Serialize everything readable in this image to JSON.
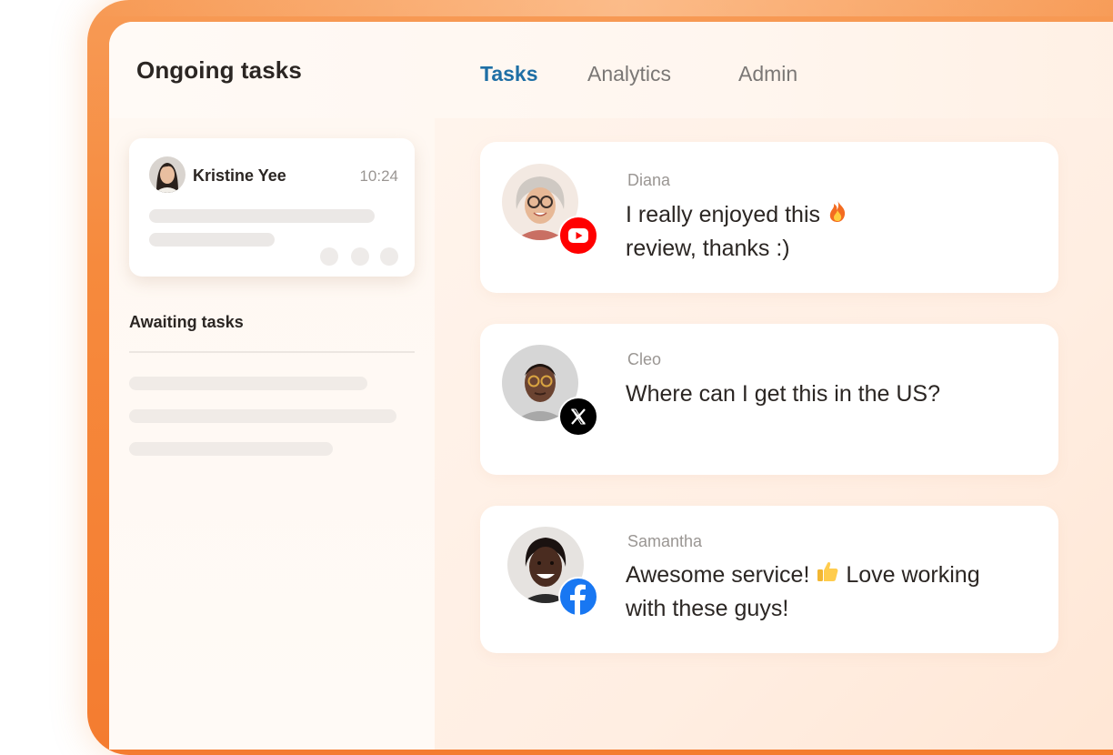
{
  "header": {
    "title": "Ongoing tasks",
    "tabs": [
      {
        "label": "Tasks",
        "active": true
      },
      {
        "label": "Analytics",
        "active": false
      },
      {
        "label": "Admin",
        "active": false
      }
    ]
  },
  "sidebar": {
    "current_task": {
      "name": "Kristine Yee",
      "time": "10:24"
    },
    "awaiting_label": "Awaiting tasks"
  },
  "messages": [
    {
      "author": "Diana",
      "line1": "I really enjoyed this",
      "line2": "review, thanks :)",
      "emoji": "fire-icon",
      "platform": "youtube-icon"
    },
    {
      "author": "Cleo",
      "line1": "Where can I get this in the US?",
      "platform": "x-icon"
    },
    {
      "author": "Samantha",
      "line1a": "Awesome service!",
      "line1b": "Love working",
      "line2": "with these guys!",
      "emoji": "thumbs-up-icon",
      "platform": "facebook-icon"
    }
  ],
  "colors": {
    "accent": "#1e6fa5",
    "frame": "#f68a3d",
    "youtube": "#ff0000",
    "facebook": "#1877f2",
    "x": "#000000"
  }
}
